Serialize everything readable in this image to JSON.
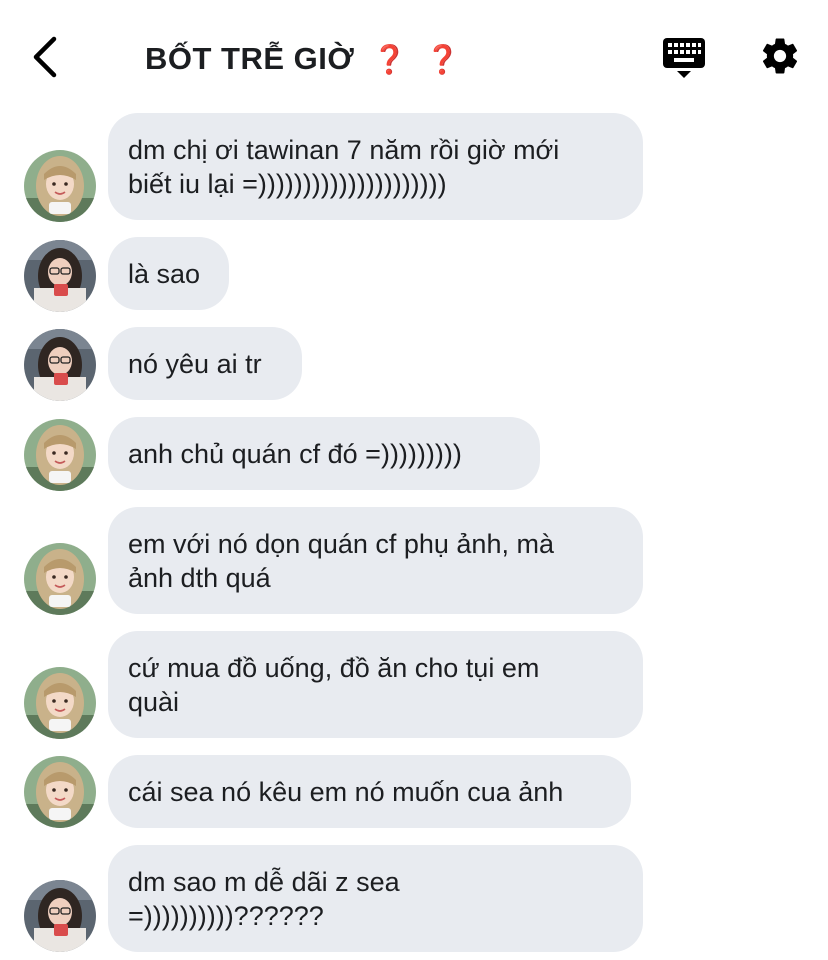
{
  "header": {
    "title": "BỐT TRỄ GIỜ",
    "title_emoji": [
      "❓",
      "❓"
    ],
    "back_icon": "chevron-left-icon",
    "keyboard_icon": "keyboard-icon",
    "settings_icon": "gear-icon"
  },
  "messages": [
    {
      "sender": "girl-blonde",
      "text": "dm chị ơi tawinan 7 năm rồi giờ mới\nbiết iu lại =)))))))))))))))))))))"
    },
    {
      "sender": "girl-dark",
      "text": "là sao"
    },
    {
      "sender": "girl-dark",
      "text": "nó yêu ai tr"
    },
    {
      "sender": "girl-blonde",
      "text": "anh chủ quán cf đó =)))))))))"
    },
    {
      "sender": "girl-blonde",
      "text": "em với nó dọn quán cf phụ ảnh, mà\nảnh dth quá"
    },
    {
      "sender": "girl-blonde",
      "text": "cứ mua đồ uống, đồ ăn cho tụi em\nquài"
    },
    {
      "sender": "girl-blonde",
      "text": "cái sea nó kêu em nó muốn cua ảnh"
    },
    {
      "sender": "girl-dark",
      "text": "dm sao m dễ dãi z sea\n=))))))))))??????"
    }
  ],
  "colors": {
    "bubble": "#e8ebf0",
    "text": "#1c1e21",
    "question_mark": "#e0302b"
  }
}
